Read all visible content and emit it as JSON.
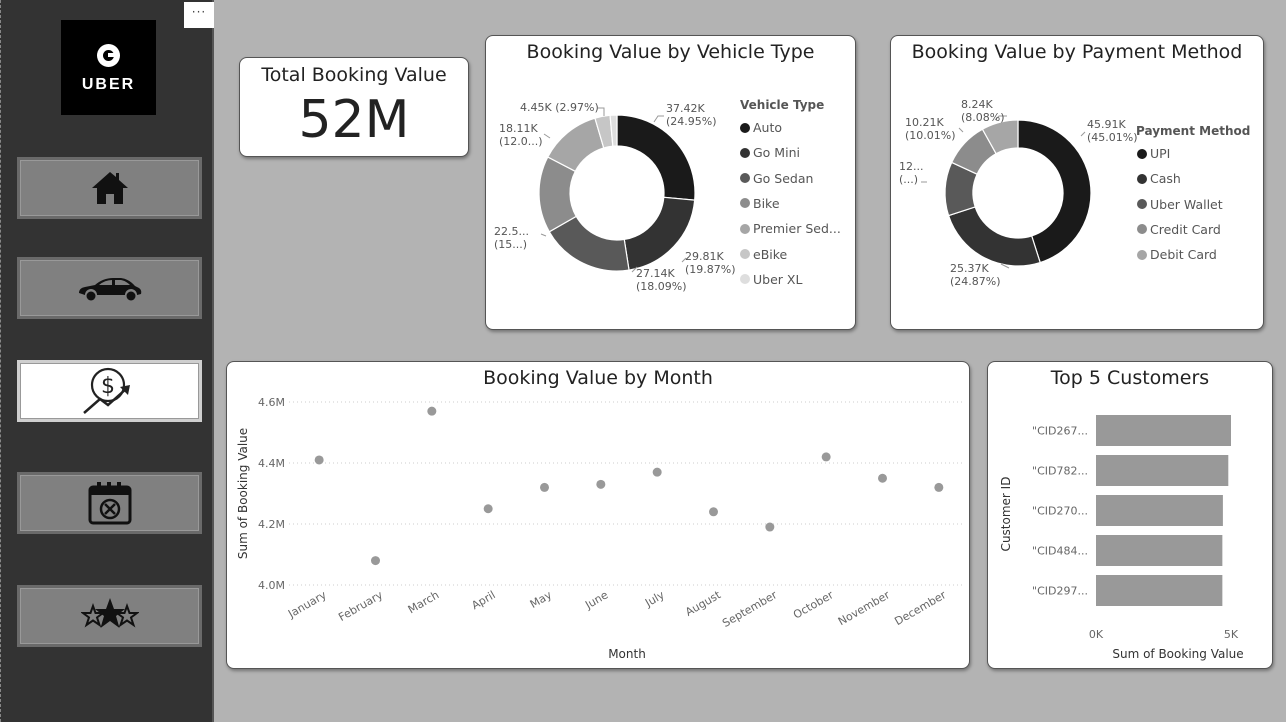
{
  "sidebar": {
    "more_label": "···",
    "logo_text": "UBER",
    "nav": [
      {
        "icon": "home-icon",
        "active": false
      },
      {
        "icon": "car-icon",
        "active": false
      },
      {
        "icon": "revenue-growth-icon",
        "active": true
      },
      {
        "icon": "calendar-cancel-icon",
        "active": false
      },
      {
        "icon": "stars-icon",
        "active": false
      }
    ]
  },
  "kpi": {
    "label": "Total Booking Value",
    "value": "52M"
  },
  "colors": {
    "page_bg": "#b3b3b3",
    "sidebar_bg": "#333333",
    "card_bg": "#ffffff",
    "series_shades": [
      "#1a1a1a",
      "#333333",
      "#595959",
      "#8c8c8c",
      "#a6a6a6",
      "#c6c6c6",
      "#dedede"
    ],
    "bar": "#999999",
    "scatter_point": "#999999"
  },
  "chart_data": [
    {
      "id": "vehicle",
      "type": "pie",
      "title": "Booking Value by Vehicle Type",
      "legend_title": "Vehicle Type",
      "legend_position": "right",
      "categories": [
        "Auto",
        "Go Mini",
        "Go Sedan",
        "Bike",
        "Premier Sed...",
        "eBike",
        "Uber XL"
      ],
      "values": [
        37420,
        29810,
        27140,
        22500,
        18110,
        4450,
        2000
      ],
      "data_labels": [
        [
          "37.42K",
          "(24.95%)"
        ],
        [
          "29.81K",
          "(19.87%)"
        ],
        [
          "27.14K",
          "(18.09%)"
        ],
        [
          "22.5...",
          "(15...)"
        ],
        [
          "18.11K",
          "(12.0...)"
        ],
        [
          "4.45K (2.97%)"
        ],
        [
          ""
        ]
      ]
    },
    {
      "id": "payment",
      "type": "pie",
      "title": "Booking Value by Payment Method",
      "legend_title": "Payment Method",
      "legend_position": "right",
      "categories": [
        "UPI",
        "Cash",
        "Uber Wallet",
        "Credit Card",
        "Debit Card"
      ],
      "values": [
        45910,
        25370,
        12100,
        10210,
        8240
      ],
      "data_labels": [
        [
          "45.91K",
          "(45.01%)"
        ],
        [
          "25.37K",
          "(24.87%)"
        ],
        [
          "12...",
          "(...)"
        ],
        [
          "10.21K",
          "(10.01%)"
        ],
        [
          "8.24K",
          "(8.08%)"
        ]
      ]
    },
    {
      "id": "month",
      "type": "scatter",
      "title": "Booking Value by Month",
      "xlabel": "Month",
      "ylabel": "Sum of Booking Value",
      "categories": [
        "January",
        "February",
        "March",
        "April",
        "May",
        "June",
        "July",
        "August",
        "September",
        "October",
        "November",
        "December"
      ],
      "values": [
        4.41,
        4.08,
        4.57,
        4.25,
        4.32,
        4.33,
        4.37,
        4.24,
        4.19,
        4.42,
        4.35,
        4.32
      ],
      "unit": "M",
      "ylim": [
        4.0,
        4.6
      ],
      "yticks": [
        "4.6M",
        "4.4M",
        "4.2M",
        "4.0M"
      ],
      "grid": true
    },
    {
      "id": "customers",
      "type": "bar",
      "orientation": "horizontal",
      "title": "Top 5 Customers",
      "xlabel": "Sum of Booking Value",
      "ylabel": "Customer ID",
      "categories": [
        "\"CID267...",
        "\"CID782...",
        "\"CID270...",
        "\"CID484...",
        "\"CID297..."
      ],
      "values": [
        5.0,
        4.9,
        4.7,
        4.68,
        4.68
      ],
      "unit": "K",
      "xlim": [
        0,
        5
      ],
      "xticks": [
        "0K",
        "5K"
      ]
    }
  ]
}
